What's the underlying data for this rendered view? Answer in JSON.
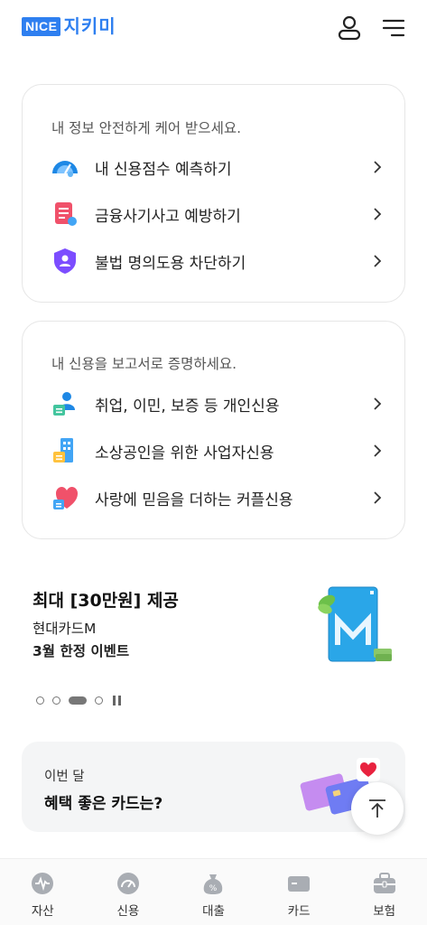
{
  "header": {
    "logo_badge": "NICE",
    "logo_text": "지키미",
    "user_icon": "user-icon",
    "menu_icon": "hamburger-menu-icon"
  },
  "protect_card": {
    "title": "내 정보 안전하게 케어 받으세요.",
    "items": [
      {
        "label": "내 신용점수 예측하기",
        "icon": "gauge-icon"
      },
      {
        "label": "금융사기사고 예방하기",
        "icon": "document-alert-icon"
      },
      {
        "label": "불법 명의도용 차단하기",
        "icon": "shield-user-icon"
      }
    ]
  },
  "report_card": {
    "title": "내 신용을 보고서로 증명하세요.",
    "items": [
      {
        "label": "취업, 이민, 보증 등 개인신용",
        "icon": "person-document-icon"
      },
      {
        "label": "소상공인을 위한 사업자신용",
        "icon": "building-icon"
      },
      {
        "label": "사랑에 믿음을 더하는 커플신용",
        "icon": "heart-document-icon"
      }
    ]
  },
  "promo": {
    "title": "최대 [30만원] 제공",
    "subtitle": "현대카드M",
    "event": "3월 한정 이벤트",
    "carousel_active_index": 2,
    "carousel_count": 4
  },
  "banner": {
    "small": "이번 달",
    "big": "혜택 좋은 카드는?"
  },
  "bottom_nav": {
    "items": [
      {
        "label": "자산",
        "icon": "asset-icon"
      },
      {
        "label": "신용",
        "icon": "credit-gauge-icon"
      },
      {
        "label": "대출",
        "icon": "money-bag-icon"
      },
      {
        "label": "카드",
        "icon": "card-icon"
      },
      {
        "label": "보험",
        "icon": "insurance-bag-icon"
      }
    ]
  },
  "colors": {
    "brand_blue": "#2e7ff0",
    "nav_icon_gray": "#a9adb3"
  }
}
